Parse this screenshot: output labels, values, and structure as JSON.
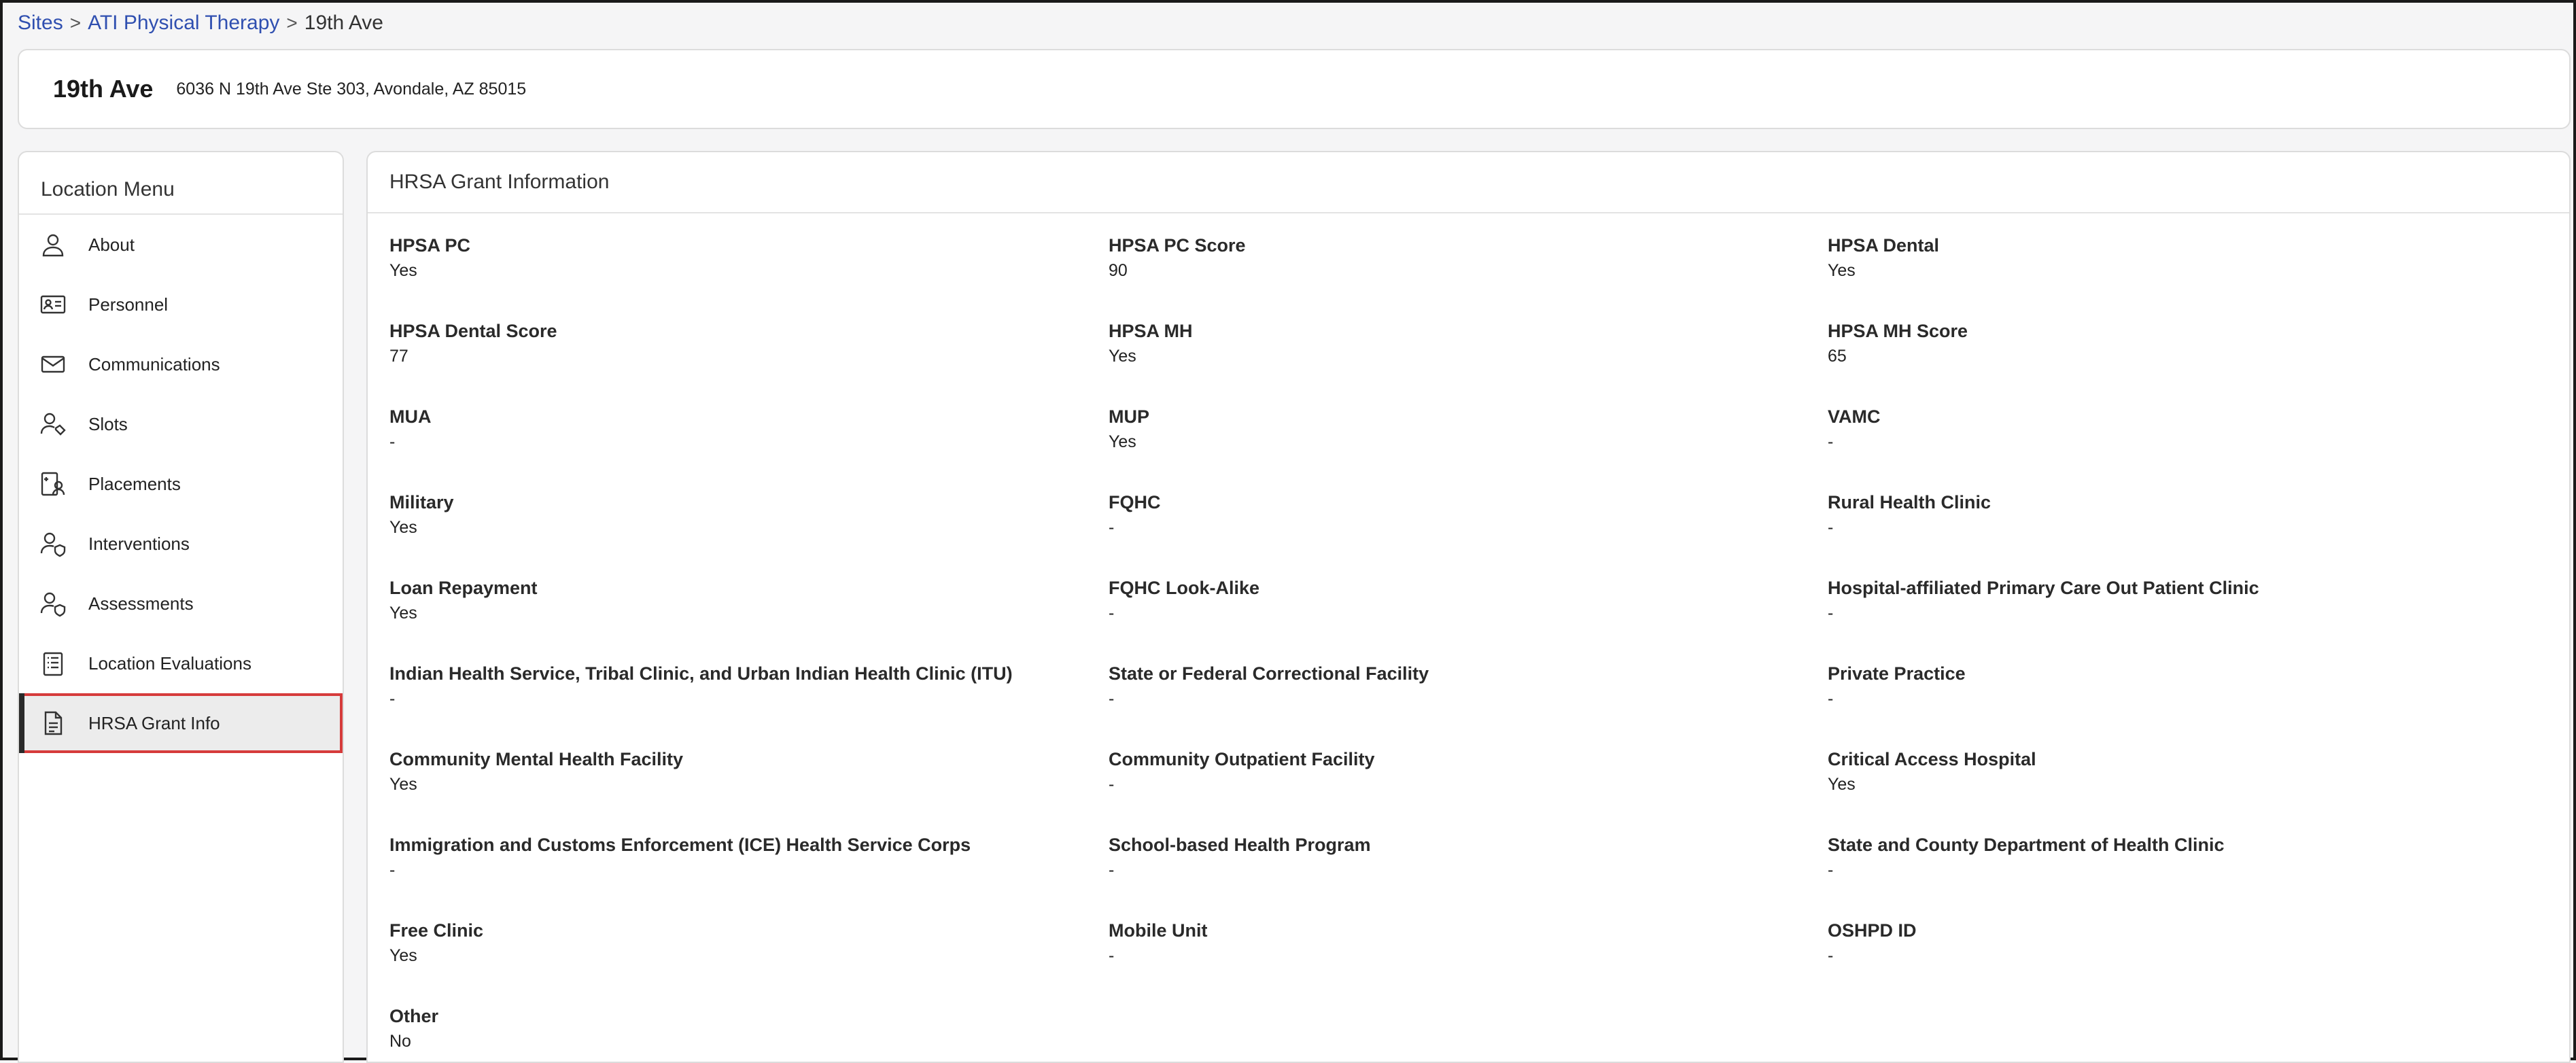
{
  "breadcrumb": {
    "sites": "Sites",
    "org": "ATI Physical Therapy",
    "current": "19th Ave",
    "separator": ">"
  },
  "header": {
    "title": "19th Ave",
    "address": "6036 N 19th Ave Ste 303, Avondale, AZ 85015"
  },
  "sidebar": {
    "title": "Location Menu",
    "items": [
      {
        "label": "About",
        "icon": "person-icon"
      },
      {
        "label": "Personnel",
        "icon": "id-card-icon"
      },
      {
        "label": "Communications",
        "icon": "envelope-icon"
      },
      {
        "label": "Slots",
        "icon": "person-tag-icon"
      },
      {
        "label": "Placements",
        "icon": "badge-person-icon"
      },
      {
        "label": "Interventions",
        "icon": "person-shield-icon"
      },
      {
        "label": "Assessments",
        "icon": "person-shield-icon"
      },
      {
        "label": "Location Evaluations",
        "icon": "checklist-icon"
      },
      {
        "label": "HRSA Grant Info",
        "icon": "document-icon",
        "active": true
      }
    ]
  },
  "main": {
    "title": "HRSA Grant Information",
    "fields": [
      {
        "label": "HPSA PC",
        "value": "Yes"
      },
      {
        "label": "HPSA PC Score",
        "value": "90"
      },
      {
        "label": "HPSA Dental",
        "value": "Yes"
      },
      {
        "label": "HPSA Dental Score",
        "value": "77"
      },
      {
        "label": "HPSA MH",
        "value": "Yes"
      },
      {
        "label": "HPSA MH Score",
        "value": "65"
      },
      {
        "label": "MUA",
        "value": "-"
      },
      {
        "label": "MUP",
        "value": "Yes"
      },
      {
        "label": "VAMC",
        "value": "-"
      },
      {
        "label": "Military",
        "value": "Yes"
      },
      {
        "label": "FQHC",
        "value": "-"
      },
      {
        "label": "Rural Health Clinic",
        "value": "-"
      },
      {
        "label": "Loan Repayment",
        "value": "Yes"
      },
      {
        "label": "FQHC Look-Alike",
        "value": "-"
      },
      {
        "label": "Hospital-affiliated Primary Care Out Patient Clinic",
        "value": "-"
      },
      {
        "label": "Indian Health Service, Tribal Clinic, and Urban Indian Health Clinic (ITU)",
        "value": "-"
      },
      {
        "label": "State or Federal Correctional Facility",
        "value": "-"
      },
      {
        "label": "Private Practice",
        "value": "-"
      },
      {
        "label": "Community Mental Health Facility",
        "value": "Yes"
      },
      {
        "label": "Community Outpatient Facility",
        "value": "-"
      },
      {
        "label": "Critical Access Hospital",
        "value": "Yes"
      },
      {
        "label": "Immigration and Customs Enforcement (ICE) Health Service Corps",
        "value": "-"
      },
      {
        "label": "School-based Health Program",
        "value": "-"
      },
      {
        "label": "State and County Department of Health Clinic",
        "value": "-"
      },
      {
        "label": "Free Clinic",
        "value": "Yes"
      },
      {
        "label": "Mobile Unit",
        "value": "-"
      },
      {
        "label": "OSHPD ID",
        "value": "-"
      },
      {
        "label": "Other",
        "value": "No"
      }
    ]
  },
  "colors": {
    "link": "#2f4fb0",
    "active_outline": "#d63b3b",
    "active_bg": "#ececec"
  }
}
